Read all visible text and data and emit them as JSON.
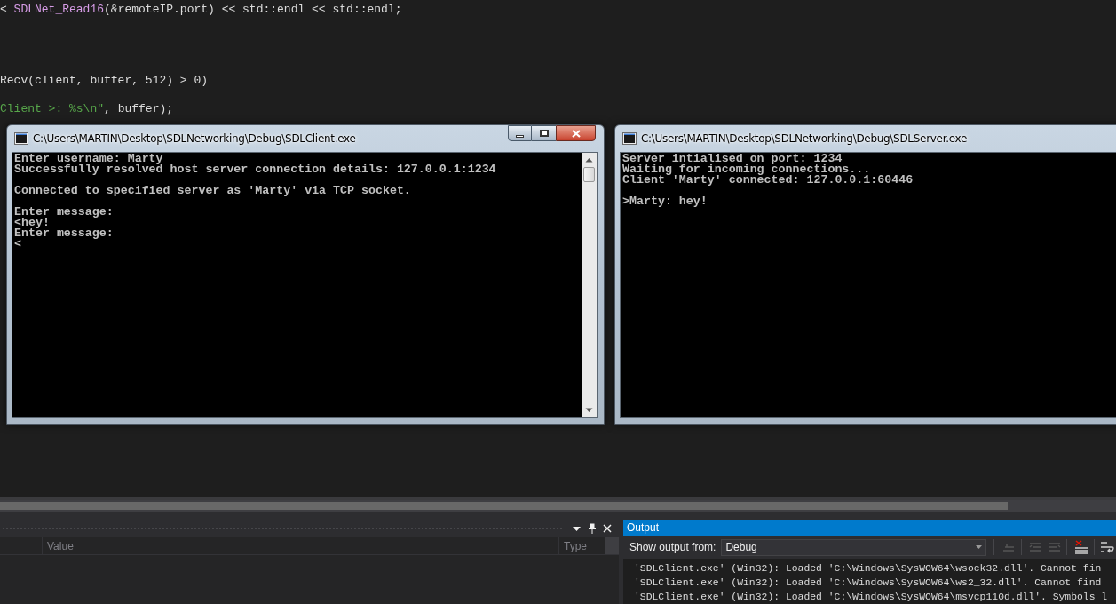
{
  "editor": {
    "code_lines": [
      {
        "segments": [
          {
            "text": "< ",
            "kind": "plain"
          },
          {
            "text": "SDLNet_Read16",
            "kind": "function"
          },
          {
            "text": "(&remoteIP.port) << std::endl << std::endl;",
            "kind": "plain"
          }
        ]
      },
      {
        "segments": [
          {
            "text": "Recv(client, buffer, 512) > 0)",
            "kind": "plain"
          }
        ]
      },
      {
        "segments": [
          {
            "text": "Client >: %s\\n\"",
            "kind": "string"
          },
          {
            "text": ", buffer);",
            "kind": "plain"
          }
        ]
      }
    ]
  },
  "windows": [
    {
      "title": "C:\\Users\\MARTIN\\Desktop\\SDLNetworking\\Debug\\SDLClient.exe",
      "controls": true,
      "scrollbar": true,
      "paragraphs": [
        [
          "Enter username: Marty",
          "Successfully resolved host server connection details: 127.0.0.1:1234"
        ],
        [
          "Connected to specified server as 'Marty' via TCP socket."
        ],
        [
          "Enter message:",
          "<hey!",
          "Enter message:",
          "<"
        ]
      ]
    },
    {
      "title": "C:\\Users\\MARTIN\\Desktop\\SDLNetworking\\Debug\\SDLServer.exe",
      "controls": false,
      "scrollbar": false,
      "paragraphs": [
        [
          "Server intialised on port: 1234",
          "Waiting for incoming connections...",
          "Client 'Marty' connected: 127.0.0.1:60446"
        ],
        [
          ">Marty: hey!"
        ]
      ]
    }
  ],
  "locals_panel": {
    "columns": [
      "Value",
      "Type"
    ]
  },
  "output_panel": {
    "title": "Output",
    "source_label": "Show output from:",
    "source": "Debug",
    "lines": [
      "'SDLClient.exe' (Win32): Loaded 'C:\\Windows\\SysWOW64\\wsock32.dll'. Cannot fin",
      "'SDLClient.exe' (Win32): Loaded 'C:\\Windows\\SysWOW64\\ws2_32.dll'. Cannot find",
      "'SDLClient.exe' (Win32): Loaded 'C:\\Windows\\SysWOW64\\msvcp110d.dll'. Symbols l"
    ]
  }
}
